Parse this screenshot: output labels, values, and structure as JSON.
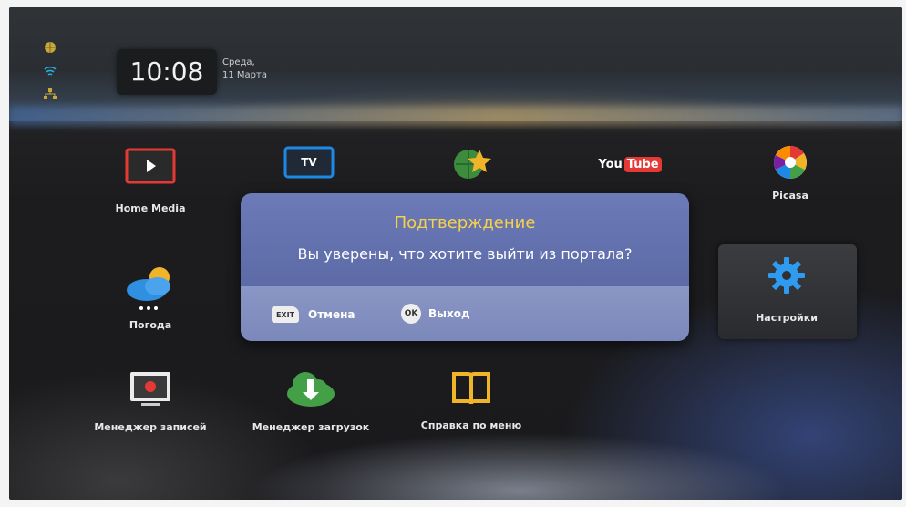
{
  "status": {
    "icons": [
      "globe-icon",
      "wifi-icon",
      "network-icon"
    ]
  },
  "clock": {
    "time": "10:08",
    "day": "Среда,",
    "date": "11 Марта"
  },
  "apps": {
    "home_media": "Home Media",
    "tv": "TV",
    "favorites": "",
    "youtube_you": "You",
    "youtube_tube": "Tube",
    "picasa": "Picasa",
    "weather": "Погода",
    "settings": "Настройки",
    "recordings": "Менеджер записей",
    "downloads": "Менеджер загрузок",
    "help": "Справка по меню"
  },
  "dialog": {
    "title": "Подтверждение",
    "message": "Вы уверены, что хотите выйти из портала?",
    "cancel_key": "EXIT",
    "cancel_label": "Отмена",
    "confirm_key": "OK",
    "confirm_label": "Выход"
  },
  "colors": {
    "dialog_title": "#f5d24a",
    "dialog_bg": "#6c7bb8",
    "accent_blue": "#1e88e5",
    "red": "#e53935",
    "green": "#43a047",
    "gold": "#f0b429"
  }
}
